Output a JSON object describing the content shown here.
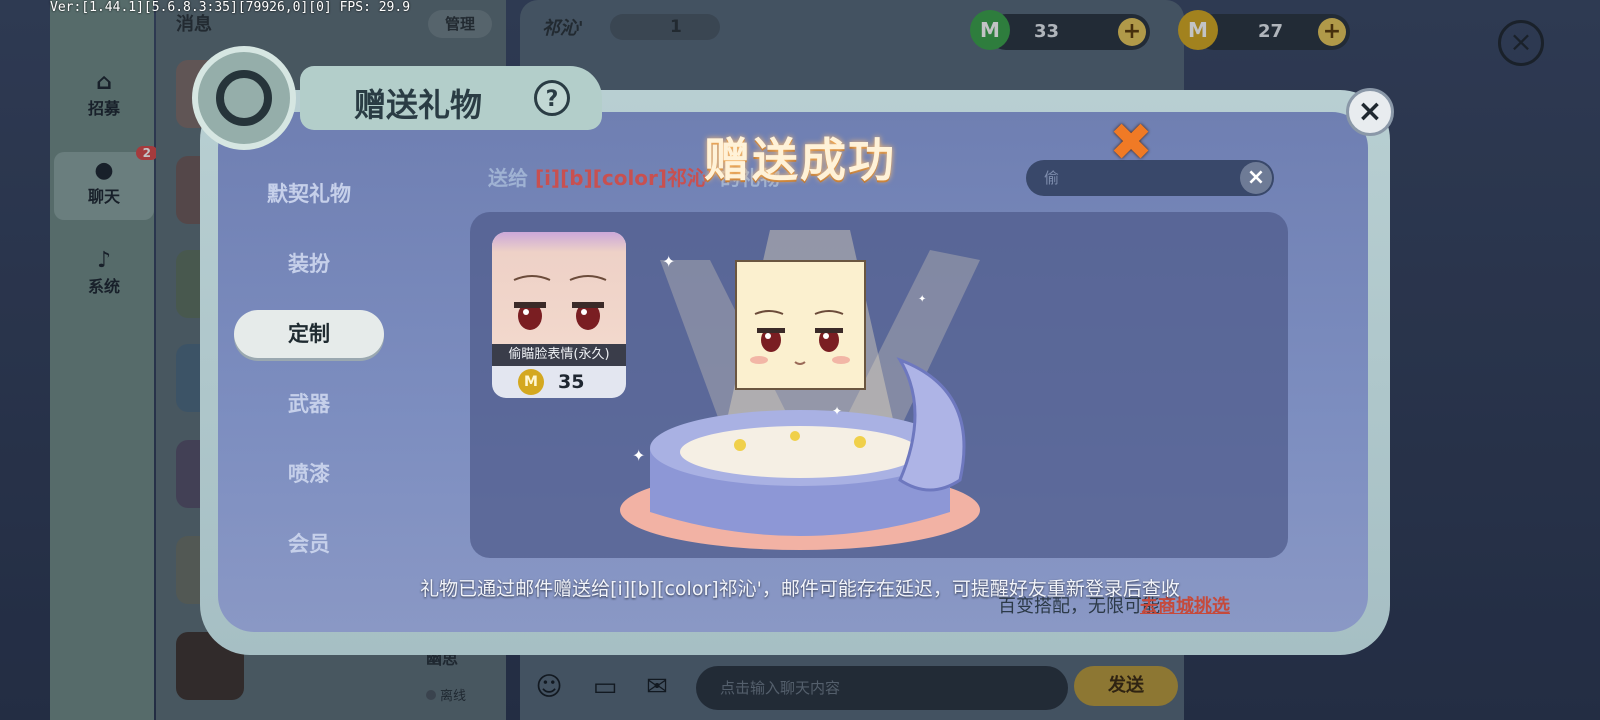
{
  "debug_text": "Ver:[1.44.1][5.6.8.3:35][79926,0][0] FPS: 29.9",
  "nav": {
    "items": [
      {
        "label": "招募",
        "icon": "home-icon"
      },
      {
        "label": "聊天",
        "icon": "chat-icon",
        "badge": "2"
      },
      {
        "label": "系统",
        "icon": "bell-icon"
      }
    ]
  },
  "friends": {
    "header": "消息",
    "manage_label": "管理",
    "bottom_name": "幽思",
    "status": "离线"
  },
  "chat": {
    "contact_name": "祁沁'",
    "contact_level": "1",
    "input_placeholder": "点击输入聊天内容",
    "send_label": "发送"
  },
  "currency": {
    "gems": "33",
    "coins": "27",
    "gem_color": "#3aa24a",
    "coin_color": "#d4a820"
  },
  "dialog": {
    "title": "赠送礼物",
    "help": "?",
    "send_to_prefix": "送给",
    "send_to_name": "[i][b][color]祁沁'",
    "send_to_suffix": "的礼物",
    "search_text": "偷",
    "categories": [
      "默契礼物",
      "装扮",
      "定制",
      "武器",
      "喷漆",
      "会员"
    ],
    "active_category": "定制",
    "item": {
      "name": "偷瞄脸表情(永久)",
      "currency_symbol": "M",
      "price": "35"
    },
    "shop_tagline": "百变搭配，无限可能",
    "shop_link": "去商城挑选"
  },
  "success": {
    "title": "赠送成功",
    "message": "礼物已通过邮件赠送给[i][b][color]祁沁'，邮件可能存在延迟，可提醒好友重新登录后查收"
  }
}
